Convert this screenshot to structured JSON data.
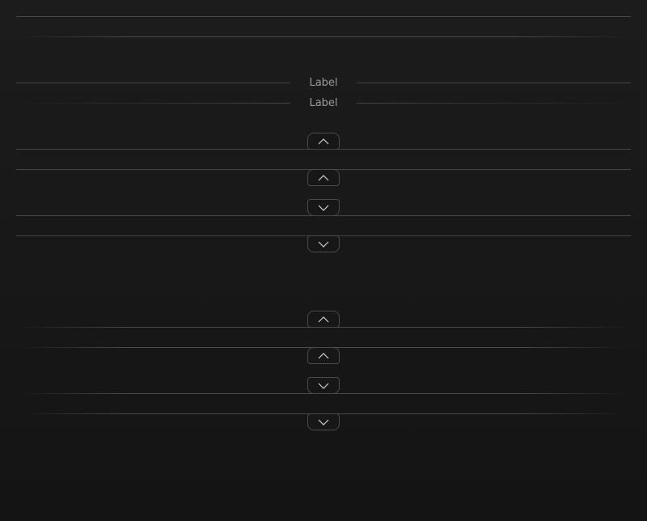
{
  "labels": {
    "first": "Label",
    "second": "Label"
  },
  "toggles": {
    "collapse_icon": "chevron-up-icon",
    "expand_icon": "chevron-down-icon"
  },
  "colors": {
    "background": "#1a1a1a",
    "divider": "#454545",
    "label_text": "#9a9a9a"
  }
}
